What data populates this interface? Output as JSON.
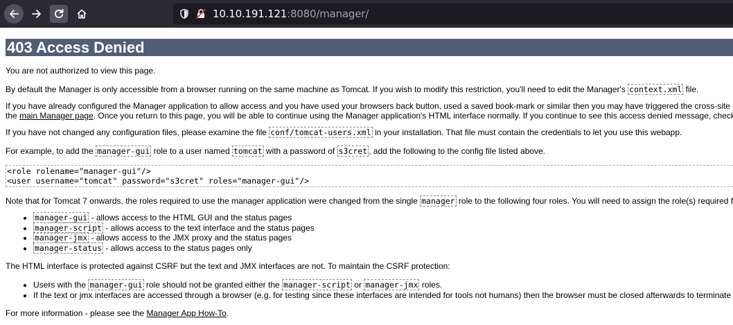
{
  "browser": {
    "url_host": "10.10.191.121",
    "url_rest": ":8080/manager/",
    "icons": [
      "back-arrow-icon",
      "forward-arrow-icon",
      "reload-icon",
      "home-icon",
      "shield-icon",
      "insecure-lock-icon"
    ]
  },
  "page": {
    "heading": "403 Access Denied",
    "p1": "You are not authorized to view this page.",
    "p2_a": "By default the Manager is only accessible from a browser running on the same machine as Tomcat. If you wish to modify this restriction, you'll need to edit the Manager's ",
    "p2_code": "context.xml",
    "p2_b": " file.",
    "p3_line1": "If you have already configured the Manager application to allow access and you have used your browsers back button, used a saved book-mark or similar then you may have triggered the cross-site r",
    "p3_a": "the ",
    "p3_link": "main Manager page",
    "p3_b": ". Once you return to this page, you will be able to continue using the Manager application's HTML interface normally. If you continue to see this access denied message, check",
    "p4_a": "If you have not changed any configuration files, please examine the file ",
    "p4_code": "conf/tomcat-users.xml",
    "p4_b": " in your installation. That file must contain the credentials to let you use this webapp.",
    "p5_a": "For example, to add the ",
    "p5_code1": "manager-gui",
    "p5_b": " role to a user named ",
    "p5_code2": "tomcat",
    "p5_c": " with a password of ",
    "p5_code3": "s3cret",
    "p5_d": ", add the following to the config file listed above.",
    "pre_line1": "<role rolename=\"manager-gui\"/>",
    "pre_line2": "<user username=\"tomcat\" password=\"s3cret\" roles=\"manager-gui\"/>",
    "p6_a": "Note that for Tomcat 7 onwards, the roles required to use the manager application were changed from the single ",
    "p6_code": "manager",
    "p6_b": " role to the following four roles. You will need to assign the role(s) required f",
    "roles": [
      {
        "code": "manager-gui",
        "text": " - allows access to the HTML GUI and the status pages"
      },
      {
        "code": "manager-script",
        "text": " - allows access to the text interface and the status pages"
      },
      {
        "code": "manager-jmx",
        "text": " - allows access to the JMX proxy and the status pages"
      },
      {
        "code": "manager-status",
        "text": " - allows access to the status pages only"
      }
    ],
    "p7": "The HTML interface is protected against CSRF but the text and JMX interfaces are not. To maintain the CSRF protection:",
    "csrf1_a": "Users with the ",
    "csrf1_code1": "manager-gui",
    "csrf1_b": " role should not be granted either the ",
    "csrf1_code2": "manager-script",
    "csrf1_c": " or ",
    "csrf1_code3": "manager-jmx",
    "csrf1_d": " roles.",
    "csrf2": "If the text or jmx interfaces are accessed through a browser (e.g. for testing since these interfaces are intended for tools not humans) then the browser must be closed afterwards to terminate",
    "p8_a": "For more information - please see the ",
    "p8_link": "Manager App How-To",
    "p8_b": "."
  }
}
